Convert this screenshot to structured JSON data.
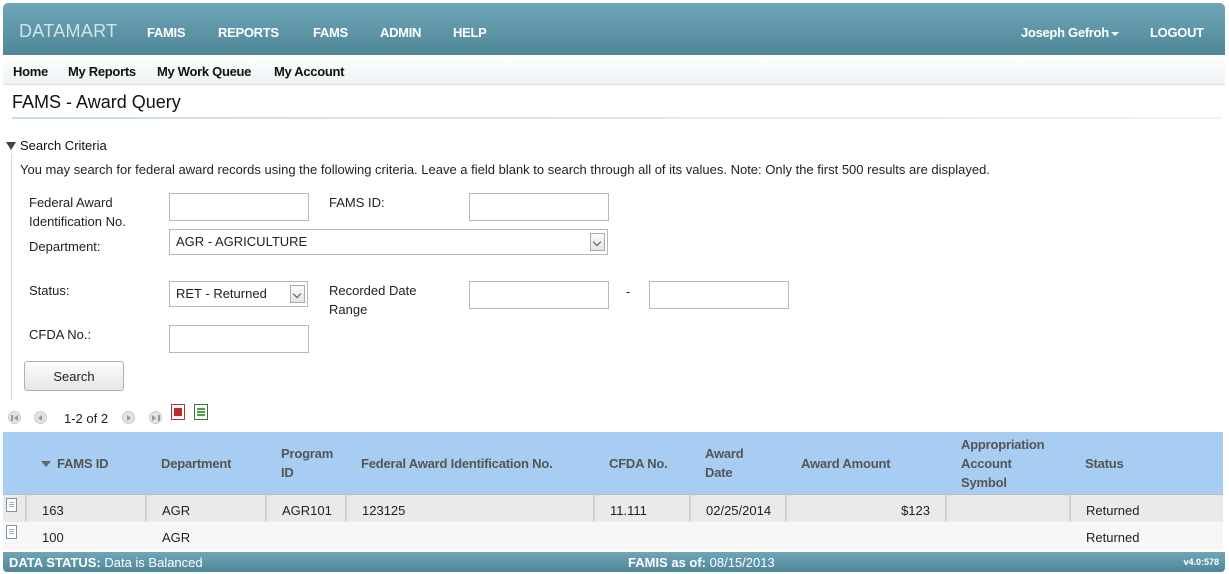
{
  "app": {
    "brand": "DATAMART"
  },
  "topnav": {
    "items": [
      "FAMIS",
      "REPORTS",
      "FAMS",
      "ADMIN",
      "HELP"
    ],
    "user": "Joseph Gefroh",
    "logout": "LOGOUT"
  },
  "subnav": {
    "items": [
      "Home",
      "My Reports",
      "My Work Queue",
      "My Account"
    ]
  },
  "page": {
    "title": "FAMS - Award Query"
  },
  "search": {
    "section_title": "Search Criteria",
    "help": "You may search for federal award records using the following criteria. Leave a field blank to search through all of its values. Note: Only the first 500 results are displayed.",
    "fields": {
      "fain_label_1": "Federal Award",
      "fain_label_2": "Identification No.",
      "fain_value": "",
      "fams_id_label": "FAMS ID:",
      "fams_id_value": "",
      "department_label": "Department:",
      "department_value": "AGR - AGRICULTURE",
      "status_label": "Status:",
      "status_value": "RET - Returned",
      "recorded_label_1": "Recorded Date",
      "recorded_label_2": "Range",
      "recorded_from": "",
      "recorded_to": "",
      "range_separator": "-",
      "cfda_label": "CFDA No.:",
      "cfda_value": ""
    },
    "button": "Search"
  },
  "pager": {
    "text": "1-2 of 2"
  },
  "grid": {
    "headers": {
      "fams_id": "FAMS ID",
      "department": "Department",
      "program_id_1": "Program",
      "program_id_2": "ID",
      "fain": "Federal Award Identification No.",
      "cfda": "CFDA No.",
      "award_date_1": "Award",
      "award_date_2": "Date",
      "award_amount": "Award Amount",
      "appr_1": "Appropriation",
      "appr_2": "Account",
      "appr_3": "Symbol",
      "status": "Status"
    },
    "rows": [
      {
        "fams_id": "163",
        "department": "AGR",
        "program_id": "AGR101",
        "fain": "123125",
        "cfda": "11.111",
        "award_date": "02/25/2014",
        "award_amount": "$123",
        "appr": "",
        "status": "Returned"
      },
      {
        "fams_id": "100",
        "department": "AGR",
        "program_id": "",
        "fain": "",
        "cfda": "",
        "award_date": "",
        "award_amount": "",
        "appr": "",
        "status": "Returned"
      }
    ]
  },
  "footer": {
    "data_status_label": "DATA STATUS:",
    "data_status_value": "Data is Balanced",
    "famis_label": "FAMIS as of:",
    "famis_value": "08/15/2013",
    "version": "v4.0:578"
  }
}
